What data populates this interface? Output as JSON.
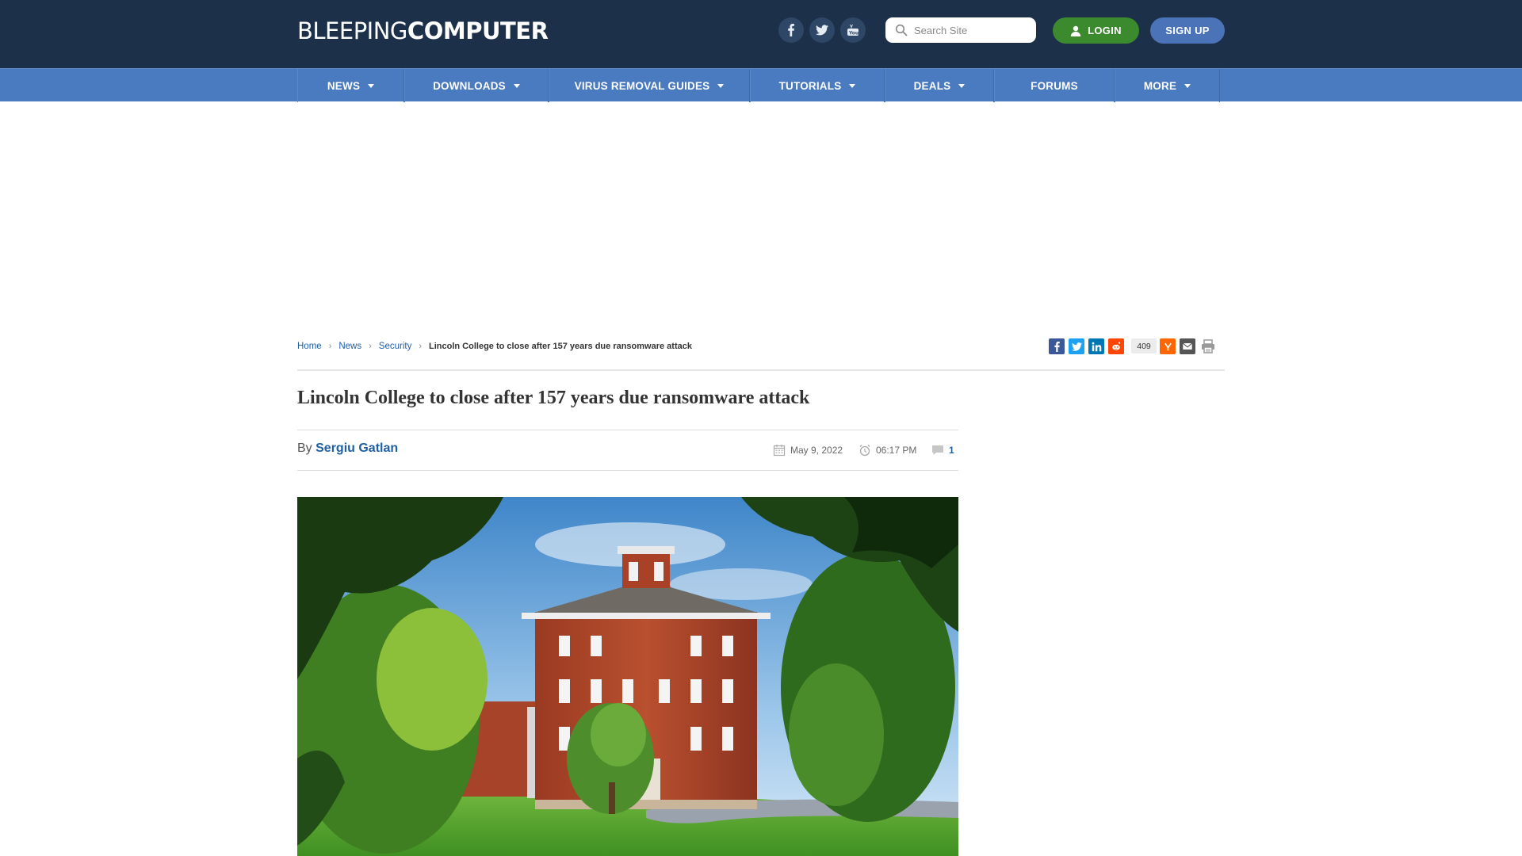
{
  "header": {
    "logo_light": "BLEEPING",
    "logo_bold": "COMPUTER",
    "search_placeholder": "Search Site",
    "login_label": "LOGIN",
    "signup_label": "SIGN UP",
    "social": [
      "facebook-icon",
      "twitter-icon",
      "youtube-icon"
    ]
  },
  "nav": {
    "items": [
      {
        "label": "NEWS",
        "dropdown": true
      },
      {
        "label": "DOWNLOADS",
        "dropdown": true
      },
      {
        "label": "VIRUS REMOVAL GUIDES",
        "dropdown": true
      },
      {
        "label": "TUTORIALS",
        "dropdown": true
      },
      {
        "label": "DEALS",
        "dropdown": true
      },
      {
        "label": "FORUMS",
        "dropdown": false
      },
      {
        "label": "MORE",
        "dropdown": true
      }
    ]
  },
  "breadcrumb": {
    "home": "Home",
    "news": "News",
    "security": "Security",
    "current": "Lincoln College to close after 157 years due ransomware attack"
  },
  "share": {
    "count": "409",
    "buttons": [
      "facebook-share-icon",
      "twitter-share-icon",
      "linkedin-share-icon",
      "reddit-share-icon",
      "hackernews-share-icon",
      "email-share-icon",
      "print-icon"
    ]
  },
  "article": {
    "title": "Lincoln College to close after 157 years due ransomware attack",
    "by_label": "By",
    "author": "Sergiu Gatlan",
    "date": "May 9, 2022",
    "time": "06:17 PM",
    "comments": "1"
  },
  "colors": {
    "header_bg": "#1c3049",
    "nav_bg": "#4a7ac0",
    "login_green": "#3c8a2e",
    "signup_blue": "#4a73b8",
    "link_blue": "#1e5fa6"
  }
}
